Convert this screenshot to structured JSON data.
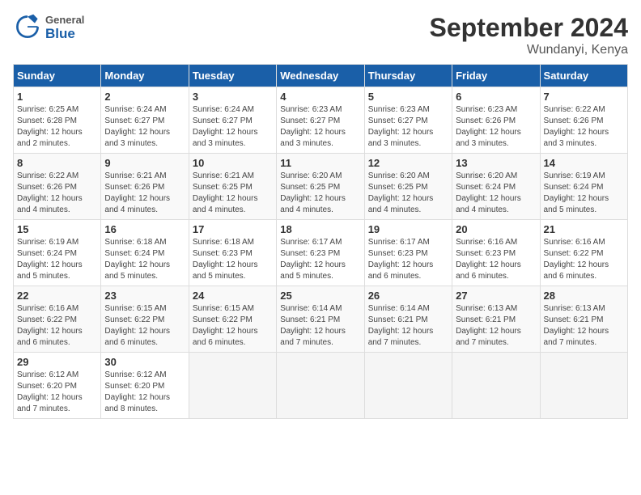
{
  "header": {
    "logo_general": "General",
    "logo_blue": "Blue",
    "month_title": "September 2024",
    "location": "Wundanyi, Kenya"
  },
  "weekdays": [
    "Sunday",
    "Monday",
    "Tuesday",
    "Wednesday",
    "Thursday",
    "Friday",
    "Saturday"
  ],
  "weeks": [
    [
      {
        "day": "1",
        "sunrise": "6:25 AM",
        "sunset": "6:28 PM",
        "daylight": "12 hours and 2 minutes."
      },
      {
        "day": "2",
        "sunrise": "6:24 AM",
        "sunset": "6:27 PM",
        "daylight": "12 hours and 3 minutes."
      },
      {
        "day": "3",
        "sunrise": "6:24 AM",
        "sunset": "6:27 PM",
        "daylight": "12 hours and 3 minutes."
      },
      {
        "day": "4",
        "sunrise": "6:23 AM",
        "sunset": "6:27 PM",
        "daylight": "12 hours and 3 minutes."
      },
      {
        "day": "5",
        "sunrise": "6:23 AM",
        "sunset": "6:27 PM",
        "daylight": "12 hours and 3 minutes."
      },
      {
        "day": "6",
        "sunrise": "6:23 AM",
        "sunset": "6:26 PM",
        "daylight": "12 hours and 3 minutes."
      },
      {
        "day": "7",
        "sunrise": "6:22 AM",
        "sunset": "6:26 PM",
        "daylight": "12 hours and 3 minutes."
      }
    ],
    [
      {
        "day": "8",
        "sunrise": "6:22 AM",
        "sunset": "6:26 PM",
        "daylight": "12 hours and 4 minutes."
      },
      {
        "day": "9",
        "sunrise": "6:21 AM",
        "sunset": "6:26 PM",
        "daylight": "12 hours and 4 minutes."
      },
      {
        "day": "10",
        "sunrise": "6:21 AM",
        "sunset": "6:25 PM",
        "daylight": "12 hours and 4 minutes."
      },
      {
        "day": "11",
        "sunrise": "6:20 AM",
        "sunset": "6:25 PM",
        "daylight": "12 hours and 4 minutes."
      },
      {
        "day": "12",
        "sunrise": "6:20 AM",
        "sunset": "6:25 PM",
        "daylight": "12 hours and 4 minutes."
      },
      {
        "day": "13",
        "sunrise": "6:20 AM",
        "sunset": "6:24 PM",
        "daylight": "12 hours and 4 minutes."
      },
      {
        "day": "14",
        "sunrise": "6:19 AM",
        "sunset": "6:24 PM",
        "daylight": "12 hours and 5 minutes."
      }
    ],
    [
      {
        "day": "15",
        "sunrise": "6:19 AM",
        "sunset": "6:24 PM",
        "daylight": "12 hours and 5 minutes."
      },
      {
        "day": "16",
        "sunrise": "6:18 AM",
        "sunset": "6:24 PM",
        "daylight": "12 hours and 5 minutes."
      },
      {
        "day": "17",
        "sunrise": "6:18 AM",
        "sunset": "6:23 PM",
        "daylight": "12 hours and 5 minutes."
      },
      {
        "day": "18",
        "sunrise": "6:17 AM",
        "sunset": "6:23 PM",
        "daylight": "12 hours and 5 minutes."
      },
      {
        "day": "19",
        "sunrise": "6:17 AM",
        "sunset": "6:23 PM",
        "daylight": "12 hours and 6 minutes."
      },
      {
        "day": "20",
        "sunrise": "6:16 AM",
        "sunset": "6:23 PM",
        "daylight": "12 hours and 6 minutes."
      },
      {
        "day": "21",
        "sunrise": "6:16 AM",
        "sunset": "6:22 PM",
        "daylight": "12 hours and 6 minutes."
      }
    ],
    [
      {
        "day": "22",
        "sunrise": "6:16 AM",
        "sunset": "6:22 PM",
        "daylight": "12 hours and 6 minutes."
      },
      {
        "day": "23",
        "sunrise": "6:15 AM",
        "sunset": "6:22 PM",
        "daylight": "12 hours and 6 minutes."
      },
      {
        "day": "24",
        "sunrise": "6:15 AM",
        "sunset": "6:22 PM",
        "daylight": "12 hours and 6 minutes."
      },
      {
        "day": "25",
        "sunrise": "6:14 AM",
        "sunset": "6:21 PM",
        "daylight": "12 hours and 7 minutes."
      },
      {
        "day": "26",
        "sunrise": "6:14 AM",
        "sunset": "6:21 PM",
        "daylight": "12 hours and 7 minutes."
      },
      {
        "day": "27",
        "sunrise": "6:13 AM",
        "sunset": "6:21 PM",
        "daylight": "12 hours and 7 minutes."
      },
      {
        "day": "28",
        "sunrise": "6:13 AM",
        "sunset": "6:21 PM",
        "daylight": "12 hours and 7 minutes."
      }
    ],
    [
      {
        "day": "29",
        "sunrise": "6:12 AM",
        "sunset": "6:20 PM",
        "daylight": "12 hours and 7 minutes."
      },
      {
        "day": "30",
        "sunrise": "6:12 AM",
        "sunset": "6:20 PM",
        "daylight": "12 hours and 8 minutes."
      },
      null,
      null,
      null,
      null,
      null
    ]
  ]
}
